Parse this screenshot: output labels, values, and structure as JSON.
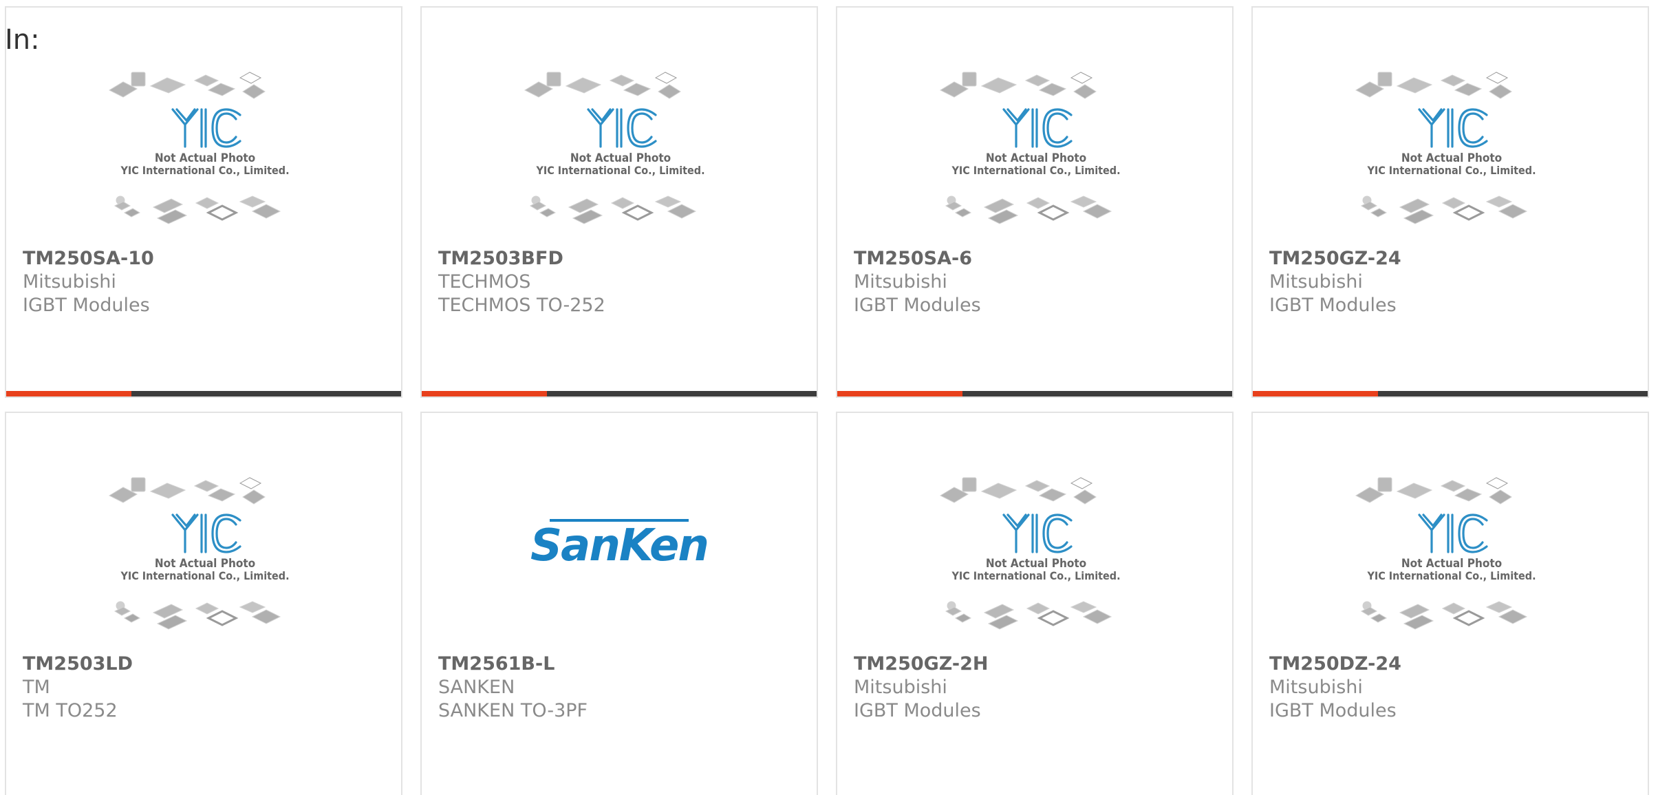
{
  "header": {
    "in_label": "In:"
  },
  "placeholder": {
    "brand": "YIC",
    "line1": "Not Actual Photo",
    "line2": "YIC International Co., Limited."
  },
  "colors": {
    "accent": "#e8401c",
    "bar": "#3c3c3c",
    "yic_blue": "#2d8fc6",
    "sanken_blue": "#1a82c4"
  },
  "products": [
    {
      "part": "TM250SA-10",
      "manufacturer": "Mitsubishi",
      "category": "IGBT Modules",
      "image": "yic-placeholder"
    },
    {
      "part": "TM2503BFD",
      "manufacturer": "TECHMOS",
      "category": "TECHMOS TO-252",
      "image": "yic-placeholder"
    },
    {
      "part": "TM250SA-6",
      "manufacturer": "Mitsubishi",
      "category": "IGBT Modules",
      "image": "yic-placeholder"
    },
    {
      "part": "TM250GZ-24",
      "manufacturer": "Mitsubishi",
      "category": "IGBT Modules",
      "image": "yic-placeholder"
    },
    {
      "part": "TM2503LD",
      "manufacturer": "TM",
      "category": "TM TO252",
      "image": "yic-placeholder"
    },
    {
      "part": "TM2561B-L",
      "manufacturer": "SANKEN",
      "category": "SANKEN TO-3PF",
      "image": "sanken-logo",
      "logo_text": "SanKen"
    },
    {
      "part": "TM250GZ-2H",
      "manufacturer": "Mitsubishi",
      "category": "IGBT Modules",
      "image": "yic-placeholder"
    },
    {
      "part": "TM250DZ-24",
      "manufacturer": "Mitsubishi",
      "category": "IGBT Modules",
      "image": "yic-placeholder"
    }
  ]
}
